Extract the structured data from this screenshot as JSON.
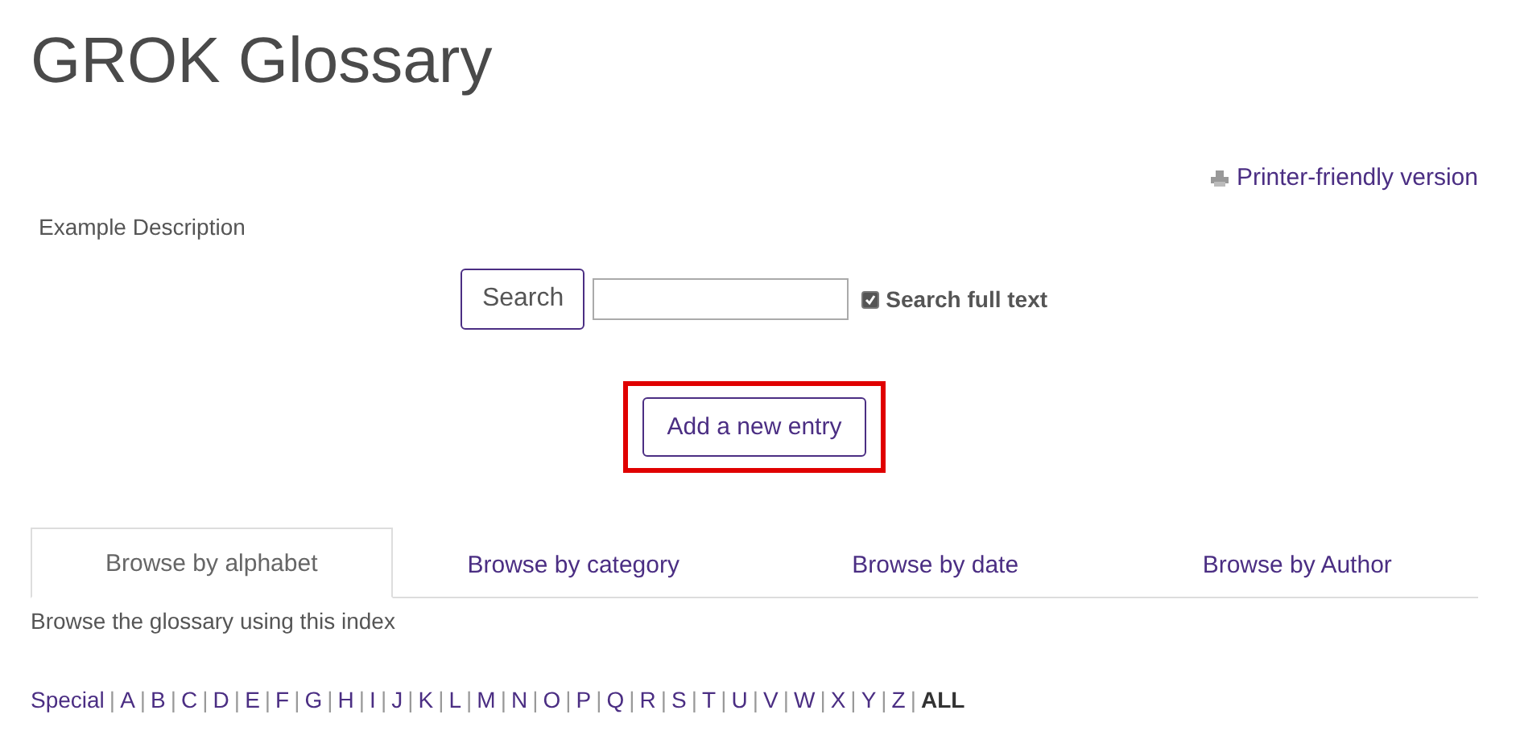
{
  "title": "GROK Glossary",
  "printer_link": "Printer-friendly version",
  "description": "Example Description",
  "search": {
    "button": "Search",
    "full_text": {
      "label": "Search full text",
      "checked": true
    }
  },
  "add_button": {
    "label": "Add a new entry",
    "highlighted": true
  },
  "tabs": [
    {
      "label": "Browse by alphabet",
      "selected": true
    },
    {
      "label": "Browse by category",
      "selected": false
    },
    {
      "label": "Browse by date",
      "selected": false
    },
    {
      "label": "Browse by Author",
      "selected": false
    }
  ],
  "tab_hint": "Browse the glossary using this index",
  "index": {
    "separator": "|",
    "letters": [
      {
        "label": "Special",
        "selected": false
      },
      {
        "label": "A",
        "selected": false
      },
      {
        "label": "B",
        "selected": false
      },
      {
        "label": "C",
        "selected": false
      },
      {
        "label": "D",
        "selected": false
      },
      {
        "label": "E",
        "selected": false
      },
      {
        "label": "F",
        "selected": false
      },
      {
        "label": "G",
        "selected": false
      },
      {
        "label": "H",
        "selected": false
      },
      {
        "label": "I",
        "selected": false
      },
      {
        "label": "J",
        "selected": false
      },
      {
        "label": "K",
        "selected": false
      },
      {
        "label": "L",
        "selected": false
      },
      {
        "label": "M",
        "selected": false
      },
      {
        "label": "N",
        "selected": false
      },
      {
        "label": "O",
        "selected": false
      },
      {
        "label": "P",
        "selected": false
      },
      {
        "label": "Q",
        "selected": false
      },
      {
        "label": "R",
        "selected": false
      },
      {
        "label": "S",
        "selected": false
      },
      {
        "label": "T",
        "selected": false
      },
      {
        "label": "U",
        "selected": false
      },
      {
        "label": "V",
        "selected": false
      },
      {
        "label": "W",
        "selected": false
      },
      {
        "label": "X",
        "selected": false
      },
      {
        "label": "Y",
        "selected": false
      },
      {
        "label": "Z",
        "selected": false
      },
      {
        "label": "ALL",
        "selected": true
      }
    ]
  }
}
